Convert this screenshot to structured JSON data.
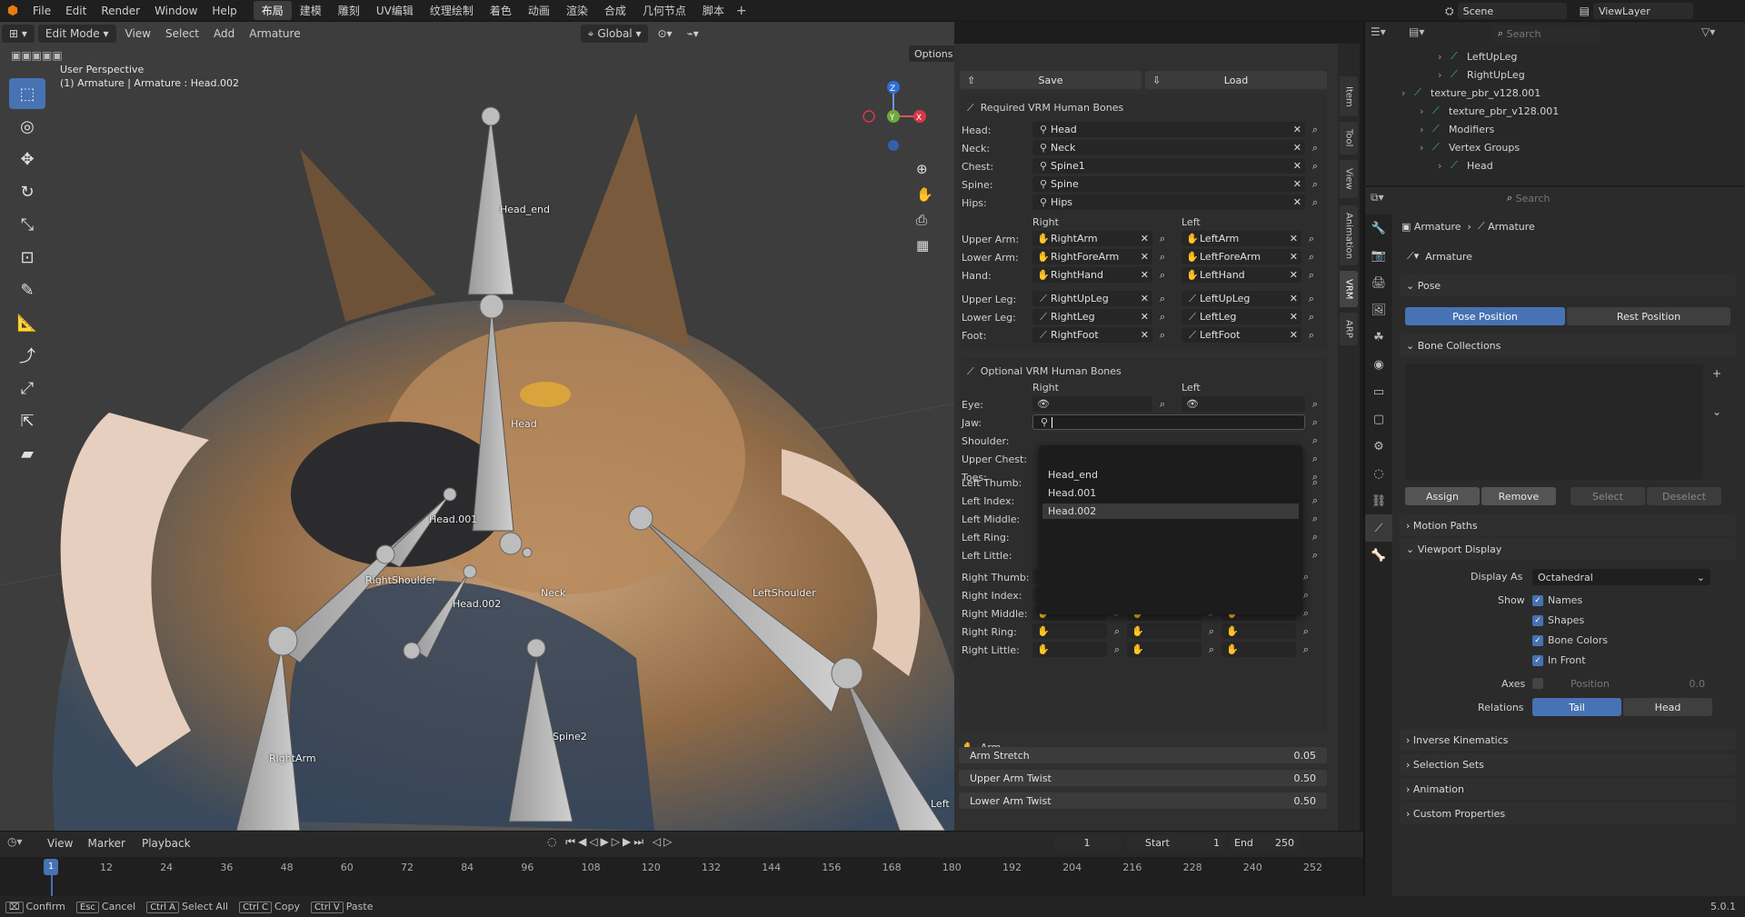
{
  "topbar": {
    "menus": [
      "File",
      "Edit",
      "Render",
      "Window",
      "Help"
    ],
    "workspaces": [
      "布局",
      "建模",
      "雕刻",
      "UV编辑",
      "纹理绘制",
      "着色",
      "动画",
      "渲染",
      "合成",
      "几何节点",
      "脚本"
    ],
    "active_workspace": 0,
    "scene": "Scene",
    "view_layer": "ViewLayer"
  },
  "viewport": {
    "mode": "Edit Mode",
    "menus": [
      "View",
      "Select",
      "Add",
      "Armature"
    ],
    "orientation": "Global",
    "options": "Options",
    "perspective": "User Perspective",
    "context": "(1) Armature | Armature : Head.002",
    "bone_labels": [
      {
        "id": "head-end",
        "text": "Head_end"
      },
      {
        "id": "head",
        "text": "Head"
      },
      {
        "id": "head001",
        "text": "Head.001"
      },
      {
        "id": "right-shoulder",
        "text": "RightShoulder"
      },
      {
        "id": "head002",
        "text": "Head.002"
      },
      {
        "id": "neck",
        "text": "Neck"
      },
      {
        "id": "left-shoulder",
        "text": "LeftShoulder"
      },
      {
        "id": "spine2",
        "text": "Spine2"
      },
      {
        "id": "right-arm",
        "text": "RightArm"
      },
      {
        "id": "left-cut",
        "text": "Left"
      }
    ]
  },
  "vrm": {
    "save": "Save",
    "load": "Load",
    "required_title": "Required VRM Human Bones",
    "required_single": [
      {
        "label": "Head:",
        "value": "Head"
      },
      {
        "label": "Neck:",
        "value": "Neck"
      },
      {
        "label": "Chest:",
        "value": "Spine1"
      },
      {
        "label": "Spine:",
        "value": "Spine"
      },
      {
        "label": "Hips:",
        "value": "Hips"
      }
    ],
    "right": "Right",
    "left": "Left",
    "required_pairs": [
      {
        "label": "Upper Arm:",
        "right": "RightArm",
        "left": "LeftArm"
      },
      {
        "label": "Lower Arm:",
        "right": "RightForeArm",
        "left": "LeftForeArm"
      },
      {
        "label": "Hand:",
        "right": "RightHand",
        "left": "LeftHand"
      },
      {
        "label": "Upper Leg:",
        "right": "RightUpLeg",
        "left": "LeftUpLeg"
      },
      {
        "label": "Lower Leg:",
        "right": "RightLeg",
        "left": "LeftLeg"
      },
      {
        "label": "Foot:",
        "right": "RightFoot",
        "left": "LeftFoot"
      }
    ],
    "optional_title": "Optional VRM Human Bones",
    "optional_labels": [
      "Eye:",
      "Jaw:",
      "Shoulder:",
      "Upper Chest:",
      "Toes:"
    ],
    "finger_labels_left": [
      "Left Thumb:",
      "Left Index:",
      "Left Middle:",
      "Left Ring:",
      "Left Little:"
    ],
    "finger_labels_right": [
      "Right Thumb:",
      "Right Index:",
      "Right Middle:",
      "Right Ring:",
      "Right Little:"
    ],
    "dropdown": {
      "items": [
        "Head_end",
        "Head.001",
        "Head.002"
      ],
      "highlighted": 2
    },
    "arm_title": "Arm",
    "sliders": [
      {
        "label": "Arm Stretch",
        "value": "0.05"
      },
      {
        "label": "Upper Arm Twist",
        "value": "0.50"
      },
      {
        "label": "Lower Arm Twist",
        "value": "0.50"
      }
    ]
  },
  "sidetabs": [
    "Item",
    "Tool",
    "View",
    "Animation",
    "VRM",
    "ARP"
  ],
  "outliner": {
    "search": "Search",
    "items": [
      {
        "text": "LeftUpLeg",
        "indent": 5
      },
      {
        "text": "RightUpLeg",
        "indent": 5
      },
      {
        "text": "texture_pbr_v128.001",
        "indent": 3
      },
      {
        "text": "texture_pbr_v128.001",
        "indent": 4
      },
      {
        "text": "Modifiers",
        "indent": 4
      },
      {
        "text": "Vertex Groups",
        "indent": 4
      },
      {
        "text": "Head",
        "indent": 5
      }
    ]
  },
  "properties": {
    "search": "Search",
    "breadcrumb": [
      "Armature",
      "Armature"
    ],
    "data_name": "Armature",
    "pose_title": "Pose",
    "pose_position": "Pose Position",
    "rest_position": "Rest Position",
    "bone_collections_title": "Bone Collections",
    "assign": "Assign",
    "remove": "Remove",
    "select": "Select",
    "deselect": "Deselect",
    "motion_paths": "Motion Paths",
    "viewport_display": "Viewport Display",
    "display_as_label": "Display As",
    "display_as": "Octahedral",
    "show_label": "Show",
    "show_items": [
      "Names",
      "Shapes",
      "Bone Colors",
      "In Front"
    ],
    "axes_label": "Axes",
    "axes_position": "Position",
    "axes_value": "0.0",
    "relations_label": "Relations",
    "tail": "Tail",
    "head": "Head",
    "collapsed": [
      "Inverse Kinematics",
      "Selection Sets",
      "Animation",
      "Custom Properties"
    ]
  },
  "timeline": {
    "menus": [
      "View",
      "Marker",
      "Playback"
    ],
    "current_frame": "1",
    "start_label": "Start",
    "start": "1",
    "end_label": "End",
    "end": "250",
    "ticks": [
      "1",
      "12",
      "24",
      "36",
      "48",
      "60",
      "72",
      "84",
      "96",
      "108",
      "120",
      "132",
      "144",
      "156",
      "168",
      "180",
      "192",
      "204",
      "216",
      "228",
      "240",
      "252"
    ]
  },
  "statusbar": {
    "items": [
      {
        "key": "",
        "text": "Confirm"
      },
      {
        "key": "Esc",
        "text": "Cancel"
      },
      {
        "key": "Ctrl A",
        "text": "Select All"
      },
      {
        "key": "Ctrl C",
        "text": "Copy"
      },
      {
        "key": "Ctrl V",
        "text": "Paste"
      }
    ],
    "version": "5.0.1"
  }
}
